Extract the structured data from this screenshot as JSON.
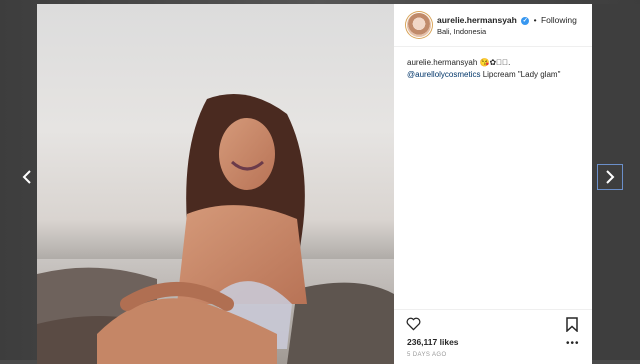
{
  "post": {
    "username": "aurelie.hermansyah",
    "follow_status": "Following",
    "separator": "•",
    "location": "Bali, Indonesia",
    "caption_user": "aurelie.hermansyah",
    "caption_emojis": "😘✿✧゚.",
    "mention": "@aurellolycosmetics",
    "caption_text": " Lipcream \"Lady glam\"",
    "likes": "236,117 likes",
    "time_ago": "5 DAYS AGO"
  },
  "icons": {
    "prev": "chevron-left-icon",
    "next": "chevron-right-icon",
    "verified": "verified-badge-icon",
    "like": "heart-icon",
    "save": "bookmark-icon",
    "more": "more-options-icon"
  },
  "colors": {
    "verified": "#3897f0",
    "mention": "#003569",
    "next_border": "#6b8fc9"
  }
}
